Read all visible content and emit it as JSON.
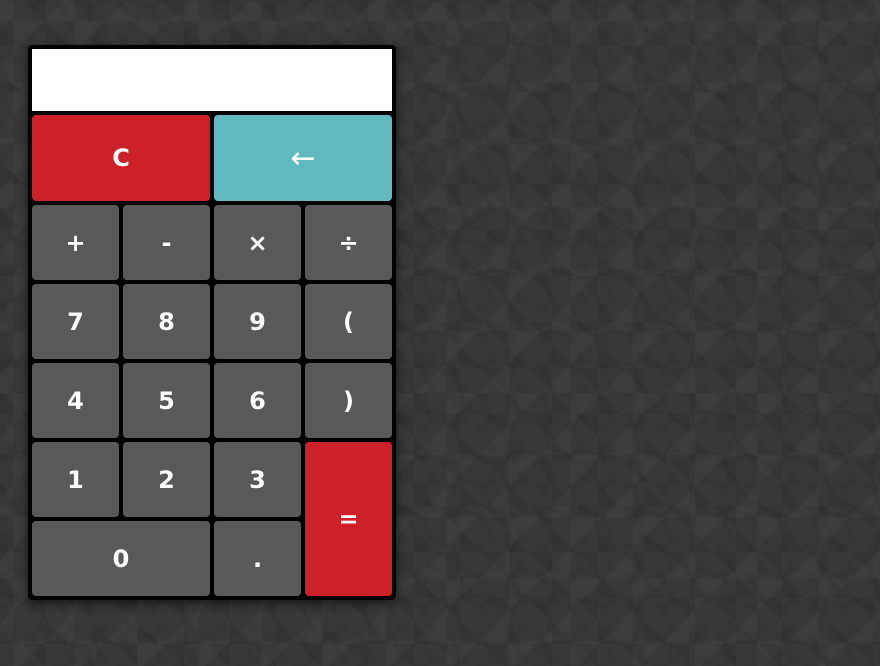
{
  "display": {
    "value": ""
  },
  "keys": {
    "clear": "C",
    "backspace": "←",
    "plus": "+",
    "minus": "-",
    "multiply": "×",
    "divide": "÷",
    "seven": "7",
    "eight": "8",
    "nine": "9",
    "open_paren": "(",
    "four": "4",
    "five": "5",
    "six": "6",
    "close_paren": ")",
    "one": "1",
    "two": "2",
    "three": "3",
    "equals": "=",
    "zero": "0",
    "decimal": "."
  },
  "colors": {
    "background": "#383838",
    "frame": "#000000",
    "key": "#595959",
    "clear": "#cc2128",
    "equals": "#cc2128",
    "backspace": "#62b8bf",
    "display": "#ffffff",
    "key_text": "#ffffff"
  }
}
